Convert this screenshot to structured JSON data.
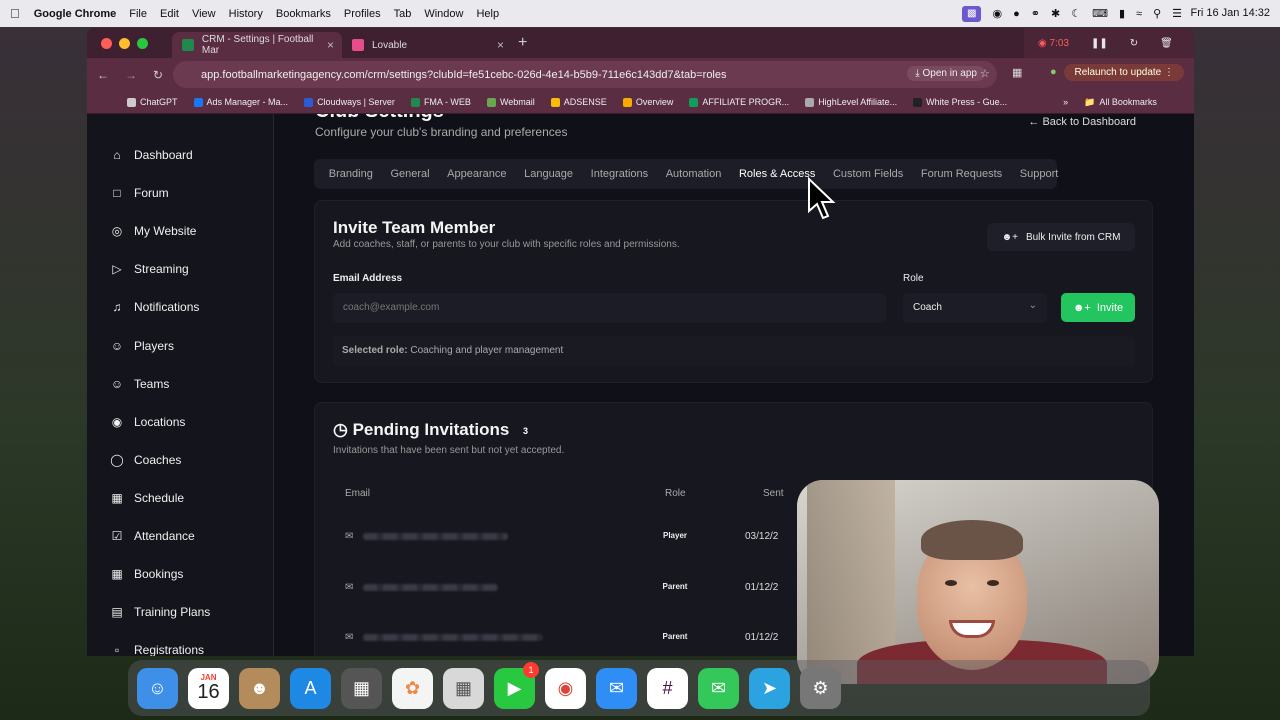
{
  "menubar": {
    "app_name": "Google Chrome",
    "items": [
      "File",
      "Edit",
      "View",
      "History",
      "Bookmarks",
      "Profiles",
      "Tab",
      "Window",
      "Help"
    ],
    "clock": "Fri 16 Jan 14:32"
  },
  "browser": {
    "tabs": [
      {
        "label": "CRM - Settings | Football Mar",
        "favicon_color": "#1f8a4c",
        "active": true
      },
      {
        "label": "Lovable",
        "favicon_color": "#e74c8b",
        "active": false
      }
    ],
    "recording_time": "7:03",
    "url": "app.footballmarketingagency.com/crm/settings?clubId=fe51cebc-026d-4e14-b5b9-711e6c143dd7&tab=roles",
    "open_in_app": "Open in app",
    "relaunch": "Relaunch to update",
    "bookmarks": [
      {
        "label": "ChatGPT",
        "color": "#cccccc"
      },
      {
        "label": "Ads Manager - Ma...",
        "color": "#1877f2"
      },
      {
        "label": "Cloudways | Server",
        "color": "#2b5cd6"
      },
      {
        "label": "FMA - WEB",
        "color": "#1f8a4c"
      },
      {
        "label": "Webmail",
        "color": "#6aa84f"
      },
      {
        "label": "ADSENSE",
        "color": "#fbbc04"
      },
      {
        "label": "Overview",
        "color": "#f9ab00"
      },
      {
        "label": "AFFILIATE PROGR...",
        "color": "#0f9d58"
      },
      {
        "label": "HighLevel Affiliate...",
        "color": "#aaaaaa"
      },
      {
        "label": "White Press - Gue...",
        "color": "#222222"
      }
    ],
    "all_bookmarks": "All Bookmarks"
  },
  "sidebar": {
    "items": [
      {
        "label": "Dashboard",
        "icon": "dashboard-icon"
      },
      {
        "label": "Forum",
        "icon": "chat-icon"
      },
      {
        "label": "My Website",
        "icon": "globe-icon"
      },
      {
        "label": "Streaming",
        "icon": "video-icon"
      },
      {
        "label": "Notifications",
        "icon": "bell-icon"
      },
      {
        "label": "Players",
        "icon": "users-icon"
      },
      {
        "label": "Teams",
        "icon": "users-icon"
      },
      {
        "label": "Locations",
        "icon": "map-pin-icon"
      },
      {
        "label": "Coaches",
        "icon": "user-circle-icon"
      },
      {
        "label": "Schedule",
        "icon": "calendar-icon"
      },
      {
        "label": "Attendance",
        "icon": "checkbox-icon"
      },
      {
        "label": "Bookings",
        "icon": "calendar-icon"
      },
      {
        "label": "Training Plans",
        "icon": "book-icon"
      },
      {
        "label": "Registrations",
        "icon": "clipboard-icon"
      }
    ]
  },
  "settings": {
    "title": "Club Settings",
    "subtitle": "Configure your club's branding and preferences",
    "back": "Back to Dashboard",
    "tabs": [
      "Branding",
      "General",
      "Appearance",
      "Language",
      "Integrations",
      "Automation",
      "Roles & Access",
      "Custom Fields",
      "Forum Requests",
      "Support"
    ],
    "active_tab": "Roles & Access"
  },
  "invite": {
    "title": "Invite Team Member",
    "subtitle": "Add coaches, staff, or parents to your club with specific roles and permissions.",
    "bulk_button": "Bulk Invite from CRM",
    "email_label": "Email Address",
    "email_placeholder": "coach@example.com",
    "role_label": "Role",
    "role_value": "Coach",
    "invite_button": "Invite",
    "selected_role_label": "Selected role:",
    "selected_role_text": "Coaching and player management"
  },
  "pending": {
    "title": "Pending Invitations",
    "count": "3",
    "subtitle": "Invitations that have been sent but not yet accepted.",
    "columns": [
      "Email",
      "Role",
      "Sent"
    ],
    "rows": [
      {
        "role": "Player",
        "sent": "03/12/2"
      },
      {
        "role": "Parent",
        "sent": "01/12/2"
      },
      {
        "role": "Parent",
        "sent": "01/12/2"
      }
    ]
  },
  "dock": {
    "calendar_month": "JAN",
    "calendar_day": "16",
    "facetime_badge": "1",
    "apps": [
      {
        "name": "finder-icon",
        "color": "#3d8fe8"
      },
      {
        "name": "calendar-icon",
        "color": "#ffffff"
      },
      {
        "name": "contacts-icon",
        "color": "#b48b5a"
      },
      {
        "name": "app-store-icon",
        "color": "#1e88e5"
      },
      {
        "name": "calculator-icon",
        "color": "#555555"
      },
      {
        "name": "photos-icon",
        "color": "#f4f4f4"
      },
      {
        "name": "launchpad-icon",
        "color": "#d8d8d8"
      },
      {
        "name": "facetime-icon",
        "color": "#28c840"
      },
      {
        "name": "chrome-icon",
        "color": "#ffffff"
      },
      {
        "name": "mail-icon",
        "color": "#2f8ef6"
      },
      {
        "name": "slack-icon",
        "color": "#ffffff"
      },
      {
        "name": "messages-icon",
        "color": "#34c759"
      },
      {
        "name": "telegram-icon",
        "color": "#2aa3e0"
      },
      {
        "name": "settings-icon",
        "color": "#777777"
      }
    ]
  }
}
